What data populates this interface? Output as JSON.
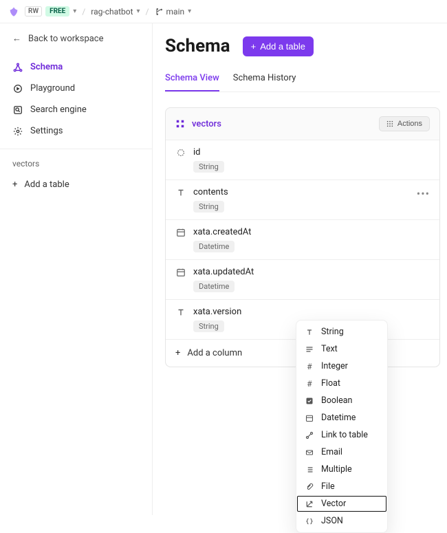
{
  "topbar": {
    "workspace_badge": "RW",
    "plan_badge": "FREE",
    "project": "rag-chatbot",
    "branch": "main"
  },
  "sidebar": {
    "back_label": "Back to workspace",
    "nav": [
      {
        "label": "Schema",
        "icon": "nodes-icon",
        "active": true
      },
      {
        "label": "Playground",
        "icon": "playground-icon",
        "active": false
      },
      {
        "label": "Search engine",
        "icon": "search-engine-icon",
        "active": false
      },
      {
        "label": "Settings",
        "icon": "gear-icon",
        "active": false
      }
    ],
    "tables_header": "vectors",
    "add_table": "Add a table"
  },
  "page": {
    "title": "Schema",
    "add_table_btn": "Add a table",
    "tabs": [
      {
        "label": "Schema View",
        "active": true
      },
      {
        "label": "Schema History",
        "active": false
      }
    ]
  },
  "table": {
    "name": "vectors",
    "actions_label": "Actions",
    "columns": [
      {
        "name": "id",
        "type": "String",
        "icon": "id-icon",
        "menu": false
      },
      {
        "name": "contents",
        "type": "String",
        "icon": "text-type-icon",
        "menu": true
      },
      {
        "name": "xata.createdAt",
        "type": "Datetime",
        "icon": "datetime-icon",
        "menu": false
      },
      {
        "name": "xata.updatedAt",
        "type": "Datetime",
        "icon": "datetime-icon",
        "menu": false
      },
      {
        "name": "xata.version",
        "type": "String",
        "icon": "text-type-icon",
        "menu": false
      }
    ],
    "add_column": "Add a column"
  },
  "dropdown": {
    "items": [
      {
        "label": "String",
        "icon": "text-type-icon"
      },
      {
        "label": "Text",
        "icon": "text-lines-icon"
      },
      {
        "label": "Integer",
        "icon": "hash-icon"
      },
      {
        "label": "Float",
        "icon": "hash-icon"
      },
      {
        "label": "Boolean",
        "icon": "checkbox-icon"
      },
      {
        "label": "Datetime",
        "icon": "datetime-icon"
      },
      {
        "label": "Link to table",
        "icon": "link-icon"
      },
      {
        "label": "Email",
        "icon": "email-icon"
      },
      {
        "label": "Multiple",
        "icon": "list-icon"
      },
      {
        "label": "File",
        "icon": "paperclip-icon"
      },
      {
        "label": "Vector",
        "icon": "vector-icon",
        "highlight": true
      },
      {
        "label": "JSON",
        "icon": "json-icon"
      }
    ]
  }
}
